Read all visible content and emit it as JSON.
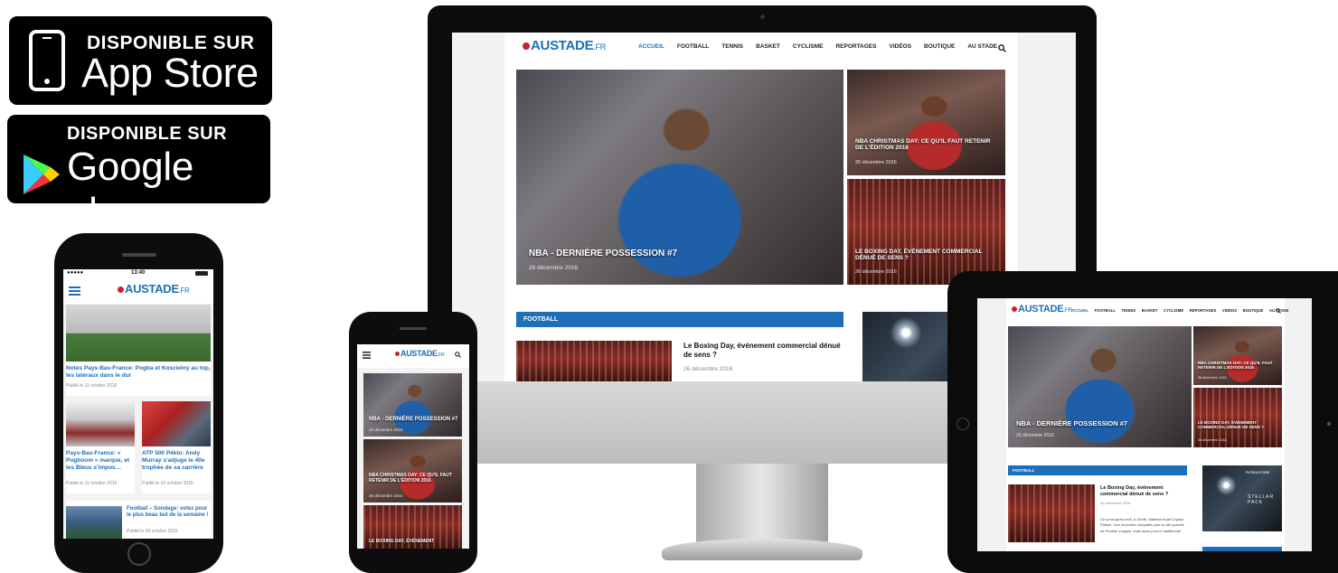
{
  "badges": {
    "appstore": {
      "small": "DISPONIBLE SUR",
      "big": "App Store"
    },
    "googleplay": {
      "small": "DISPONIBLE SUR",
      "big": "Google play"
    }
  },
  "site": {
    "logo": "AUSTADE",
    "logo_suffix": ".FR",
    "nav": [
      "ACCUEIL",
      "FOOTBALL",
      "TENNIS",
      "BASKET",
      "CYCLISME",
      "REPORTAGES",
      "VIDÉOS",
      "BOUTIQUE",
      "AU STADE"
    ],
    "nav_tablet": [
      "ACCUEIL",
      "FOOTBALL",
      "TENNIS",
      "BASKET",
      "CYCLISME",
      "REPORTAGES",
      "VIDÉOS",
      "BOUTIQUE",
      "AU STADE"
    ]
  },
  "desktop": {
    "hero": {
      "title": "NBA - DERNIÈRE POSSESSION #7",
      "date": "26 décembre 2016"
    },
    "side1": {
      "title": "NBA CHRISTMAS DAY: CE QU'IL FAUT RETENIR DE L'ÉDITION 2016",
      "date": "26 décembre 2016"
    },
    "side2": {
      "title": "LE BOXING DAY, ÉVÉNEMENT COMMERCIAL DÉNUÉ DE SENS ?",
      "date": "26 décembre 2016"
    },
    "section": "FOOTBALL",
    "article": {
      "title": "Le Boxing Day, événement commercial dénué de sens ?",
      "date": "26 décembre 2016"
    }
  },
  "small_phone": {
    "card1": "NBA - DERNIÈRE POSSESSION #7",
    "card1_date": "26 décembre 2016",
    "card2": "NBA CHRISTMAS DAY: CE QU'IL FAUT RETENIR DE L'ÉDITION 2016",
    "card2_date": "26 décembre 2016",
    "card3": "LE BOXING DAY, ÉVÉNEMENT"
  },
  "left_phone": {
    "status_carrier": "●●●●● ",
    "status_time": "13:40",
    "article1": {
      "title": "Notes Pays-Bas-France: Pogba et Koscielny au top, les latéraux dans le dur",
      "date": "Publié le 11 octobre 2016"
    },
    "article2": {
      "title": "Pays-Bas-France: « Pogboom » marque, et les Bleus s'impos…",
      "date": "Publié le 11 octobre 2016"
    },
    "article3": {
      "title": "ATP 500 Pékin: Andy Murray s'adjuge le 40e trophée de sa carrière",
      "date": "Publié le 10 octobre 2016"
    },
    "article4": {
      "title": "Football – Sondage: votez pour le plus beau but de la semaine !",
      "date": "Publié le 09 octobre 2016"
    }
  },
  "tablet": {
    "hero": {
      "title": "NBA - DERNIÈRE POSSESSION #7",
      "date": "26 décembre 2016"
    },
    "side1": {
      "title": "NBA CHRISTMAS DAY: CE QU'IL FAUT RETENIR DE L'ÉDITION 2016",
      "date": "26 décembre 2016"
    },
    "side2": {
      "title": "LE BOXING DAY, ÉVÉNEMENT COMMERCIAL DÉNUÉ DE SENS ?",
      "date": "26 décembre 2016"
    },
    "section": "FOOTBALL",
    "article": {
      "title": "Le Boxing Day, événement commercial dénué de sens ?",
      "date": "26 décembre 2016",
      "excerpt": "Ce lundi après-midi, à 13h30, Watford reçoit Crystal Palace. Une rencontre comptant pour la 18e journée de Premier League, mais aussi pour le traditionnel"
    },
    "ad_brand": "FUTBOLSTORE",
    "ad_text": "STELLAR PACK"
  },
  "colors": {
    "brand_blue": "#1d6fb8",
    "logo_red": "#d0202a"
  }
}
